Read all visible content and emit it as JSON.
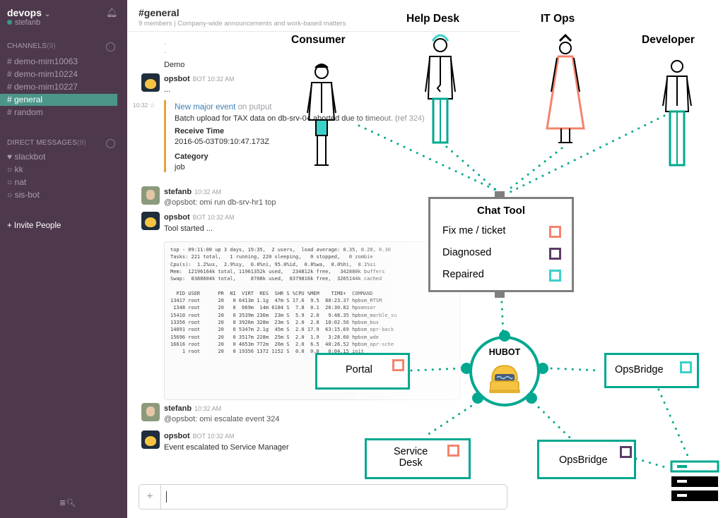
{
  "slack": {
    "team": "devops",
    "team_caret": "⌄",
    "user": "stefanb",
    "channels_header": "CHANNELS",
    "channels_count": "(9)",
    "channels": [
      "# demo-mim10063",
      "# demo-mim10224",
      "# demo-mim10227",
      "# general",
      "# random"
    ],
    "dm_header": "DIRECT MESSAGES",
    "dm_count": "(9)",
    "dms": [
      "♥ slackbot",
      "○ kk",
      "○ nat",
      "○ sis-bot"
    ],
    "invite": "+ Invite People",
    "channel_title": "#general",
    "channel_meta": "9 members  |  Company-wide announcements and work-based matters",
    "messages": {
      "dot1": ".",
      "dot2": ".",
      "demo": "Demo",
      "opsbot_name": "opsbot",
      "bot_time": "BOT  10:32 AM",
      "dash": "...",
      "time_star": "10:32 ☆",
      "event_title": "New major event",
      "event_on": "on putput",
      "event_desc": "Batch upload for TAX data on db-srv-04 aborted due to timeout. (ref 324)",
      "receive_label": "Receive Time",
      "receive_value": "2016-05-03T09:10:47.173Z",
      "category_label": "Category",
      "category_value": "job",
      "stefanb_name": "stefanb",
      "user_time": "10:32 AM",
      "cmd1": "@opsbot: omi run db-srv-hr1 top",
      "tool_started": "Tool started ...",
      "cmd2": "@opsbot: omi escalate event 324",
      "escalated": "Event escalated to Service Manager"
    },
    "code_output": "top - 09:11:00 up 3 days, 19:35,  2 users,  load average: 0.35, 0.28, 0.30\nTasks: 221 total,   1 running, 220 sleeping,   0 stopped,   0 zombie\nCpu(s):  1.2%us,  2.9%sy,  0.0%ni, 95.0%id,  0.8%wa,  0.0%hi,  0.1%si\nMem:  12196164k total, 11961352k used,   234812k free,   342880k buffers\nSwap:  8388604k total,     8708k used,  8379816k free,  3265144k cached\n\n  PID USER      PR  NI  VIRT  RES  SHR S %CPU %MEM    TIME+  COMMAND\n13417 root      20   0 6413m 1.1g  47m S 17.6  9.5  80:23.37 hpbsm_RTSM\n 1348 root      20   0  669m  14m 6184 S  7.8  0.1  26:30.82 hpsensor\n15410 root      20   0 3539m 236m  23m S  5.9  2.0   9:48.35 hpbsm_marble_su\n13356 root      20   0 3926m 328m  23m S  2.0  2.8  18:02.56 hpbsm_bus\n14091 root      20   0 5347m 2.1g  45m S  2.0 17.9  63:15.69 hpbsm_opr-back\n15696 root      20   0 3517m 228m  25m S  2.0  1.9   3:28.60 hpbsm_wde\n16616 root      20   0 4653m 772m  26m S  2.0  6.5  40:26.52 hpbsm_opr-sche\n    1 root      20   0 19356 1372 1152 S  0.0  0.0   0:04.15 init"
  },
  "diagram": {
    "personas": [
      {
        "label": "Consumer"
      },
      {
        "label": "Help Desk"
      },
      {
        "label": "IT Ops"
      },
      {
        "label": "Developer"
      }
    ],
    "chat_tool": {
      "title": "Chat Tool",
      "items": [
        {
          "label": "Fix me / ticket",
          "color": "#f4846c"
        },
        {
          "label": "Diagnosed",
          "color": "#5c3d66"
        },
        {
          "label": "Repaired",
          "color": "#3ad1c8"
        }
      ]
    },
    "hubot": {
      "label": "HUBOT"
    },
    "nodes": {
      "portal": {
        "label": "Portal",
        "status_color": "#f4846c"
      },
      "opsbridge_right": {
        "label": "OpsBridge",
        "status_color": "#3ad1c8"
      },
      "service_desk": {
        "label_line1": "Service",
        "label_line2": "Desk",
        "status_color": "#f4846c"
      },
      "opsbridge_bottom": {
        "label": "OpsBridge",
        "status_color": "#5c3d66"
      }
    },
    "colors": {
      "accent": "#00a88f",
      "frame": "#7f7f7f",
      "slack_sidebar": "#4d394b",
      "slack_active": "#4c9689"
    }
  }
}
